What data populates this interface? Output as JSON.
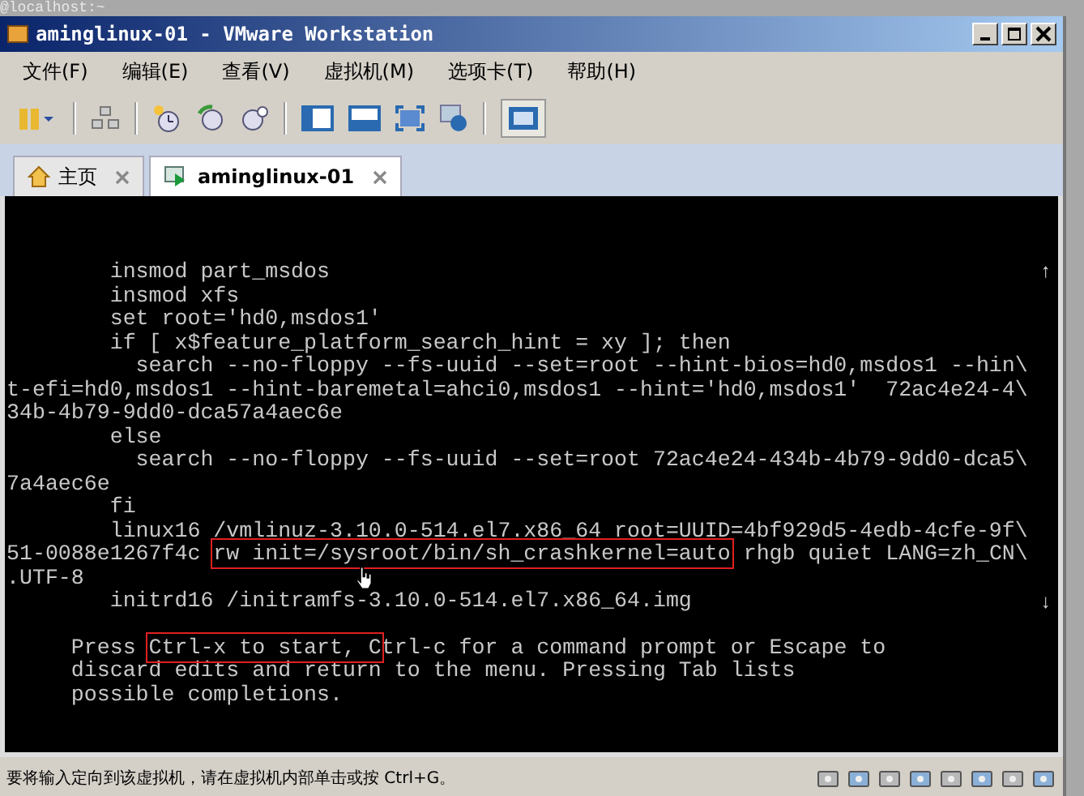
{
  "background_text": "@localhost:~",
  "window": {
    "title": "aminglinux-01 - VMware Workstation"
  },
  "menu": [
    {
      "label": "文件(F)"
    },
    {
      "label": "编辑(E)"
    },
    {
      "label": "查看(V)"
    },
    {
      "label": "虚拟机(M)"
    },
    {
      "label": "选项卡(T)"
    },
    {
      "label": "帮助(H)"
    }
  ],
  "tabs": [
    {
      "label": "主页",
      "kind": "home",
      "selected": false
    },
    {
      "label": "aminglinux-01",
      "kind": "vm",
      "selected": true
    }
  ],
  "console": {
    "scroll_up": "↑",
    "scroll_down": "↓",
    "lines": [
      [
        {
          "text": "        insmod part_msdos"
        }
      ],
      [
        {
          "text": "        insmod xfs"
        }
      ],
      [
        {
          "text": "        set root='hd0,msdos1'"
        }
      ],
      [
        {
          "text": "        if [ x$feature_platform_search_hint = xy ]; then"
        }
      ],
      [
        {
          "text": "          search --no-floppy --fs-uuid --set=root --hint-bios=hd0,msdos1 --hin\\"
        }
      ],
      [
        {
          "text": "t-efi=hd0,msdos1 --hint-baremetal=ahci0,msdos1 --hint='hd0,msdos1'  72ac4e24-4\\"
        }
      ],
      [
        {
          "text": "34b-4b79-9dd0-dca57a4aec6e"
        }
      ],
      [
        {
          "text": "        else"
        }
      ],
      [
        {
          "text": "          search --no-floppy --fs-uuid --set=root 72ac4e24-434b-4b79-9dd0-dca5\\"
        }
      ],
      [
        {
          "text": "7a4aec6e"
        }
      ],
      [
        {
          "text": "        fi"
        }
      ],
      [
        {
          "text": "        linux16 /vmlinuz-3.10.0-514.el7.x86_64 root=UUID=4bf929d5-4edb-4cfe-9f\\"
        }
      ],
      [
        {
          "text": "51-0088e1267f4c ",
          "boxed": false
        },
        {
          "text": "rw init=/sysroot/bin/sh_crashkernel=auto",
          "boxed": true
        },
        {
          "text": " rhgb quiet LANG=zh_CN\\",
          "boxed": false
        }
      ],
      [
        {
          "text": ".UTF-8"
        }
      ],
      [
        {
          "text": "        initrd16 /initramfs-3.10.0-514.el7.x86_64.img"
        }
      ]
    ],
    "help_lines": [
      [
        {
          "text": "     Press ",
          "boxed": false
        },
        {
          "text": "Ctrl-x to start, C",
          "boxed": true
        },
        {
          "text": "trl-c for a command prompt or Escape to",
          "boxed": false
        }
      ],
      [
        {
          "text": "     discard edits and return to the menu. Pressing Tab lists"
        }
      ],
      [
        {
          "text": "     possible completions."
        }
      ]
    ]
  },
  "status_bar": {
    "text": "要将输入定向到该虚拟机，请在虚拟机内部单击或按 Ctrl+G。"
  }
}
